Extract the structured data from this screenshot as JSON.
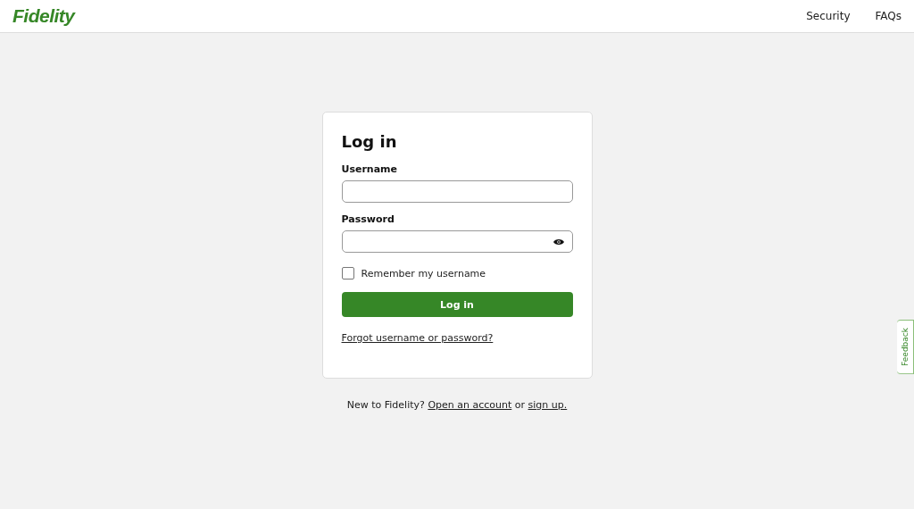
{
  "header": {
    "logo": "Fidelity",
    "nav": [
      "Security",
      "FAQs"
    ]
  },
  "login": {
    "title": "Log in",
    "username": {
      "label": "Username"
    },
    "password": {
      "label": "Password"
    },
    "remember": {
      "label": "Remember my username",
      "checked": false
    },
    "submit": "Log in",
    "forgot": "Forgot username or password?"
  },
  "footer": {
    "prefix": "New to Fidelity?",
    "link_1": "Open an account",
    "middle": "or",
    "link_2": "sign up."
  },
  "feedback": "Feedback"
}
